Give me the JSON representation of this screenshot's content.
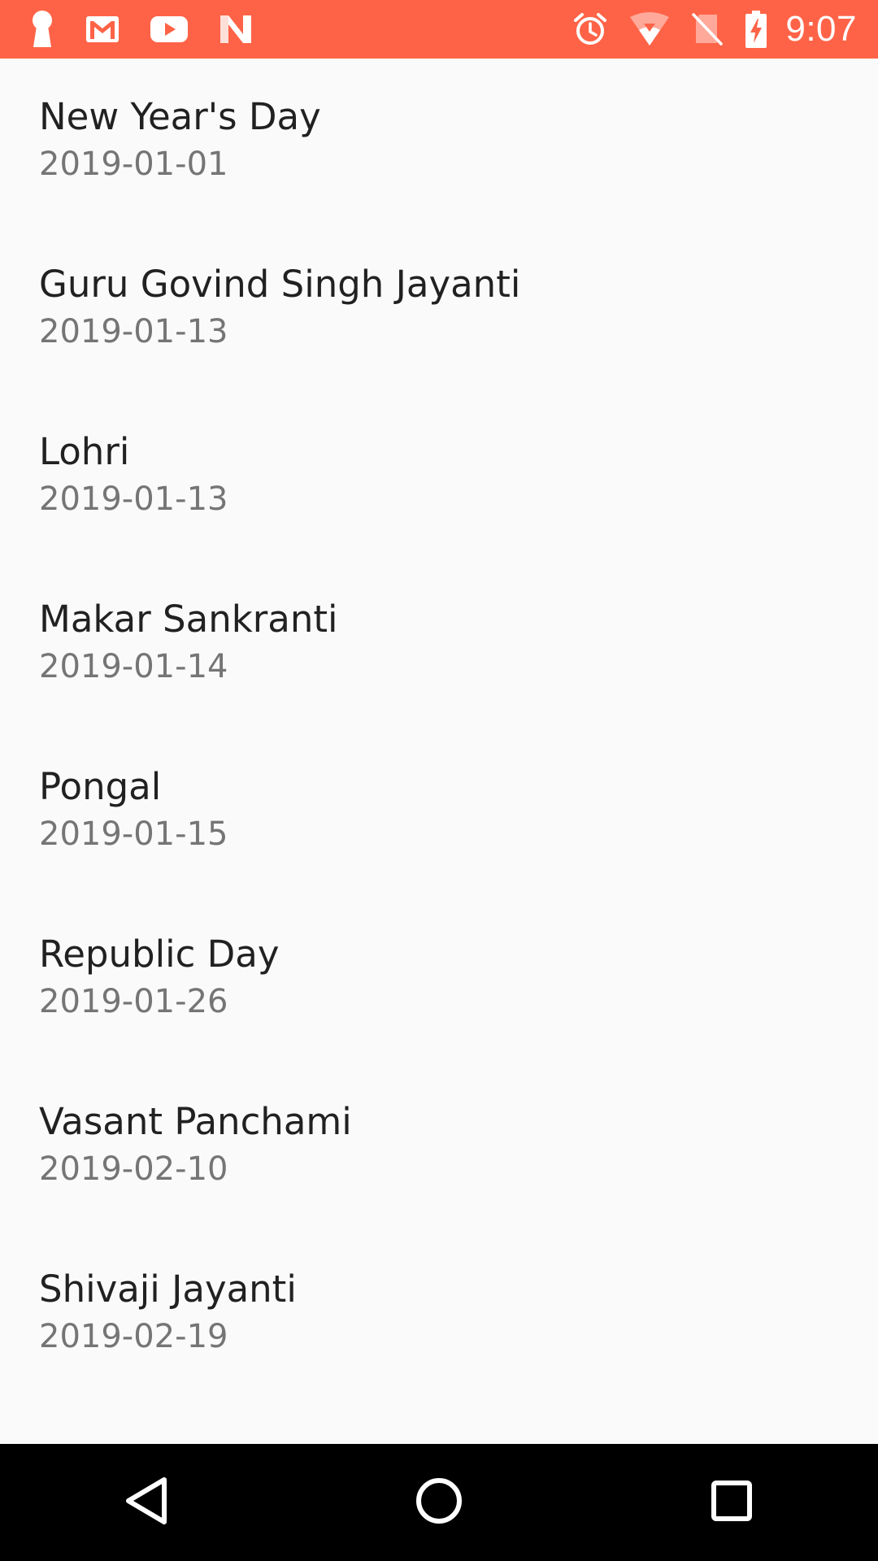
{
  "status_bar": {
    "time": "9:07",
    "background_color": "#ff6347",
    "left_icons": [
      "keyhole-icon",
      "gmail-icon",
      "youtube-icon",
      "n-app-icon"
    ],
    "right_icons": [
      "alarm-icon",
      "wifi-icon",
      "no-sim-icon",
      "battery-charging-icon"
    ]
  },
  "holidays": [
    {
      "name": "New Year's Day",
      "date": "2019-01-01"
    },
    {
      "name": "Guru Govind Singh Jayanti",
      "date": "2019-01-13"
    },
    {
      "name": "Lohri",
      "date": "2019-01-13"
    },
    {
      "name": "Makar Sankranti",
      "date": "2019-01-14"
    },
    {
      "name": "Pongal",
      "date": "2019-01-15"
    },
    {
      "name": "Republic Day",
      "date": "2019-01-26"
    },
    {
      "name": "Vasant Panchami",
      "date": "2019-02-10"
    },
    {
      "name": "Shivaji Jayanti",
      "date": "2019-02-19"
    }
  ],
  "nav_bar": {
    "buttons": [
      "back-icon",
      "home-icon",
      "recents-icon"
    ]
  }
}
